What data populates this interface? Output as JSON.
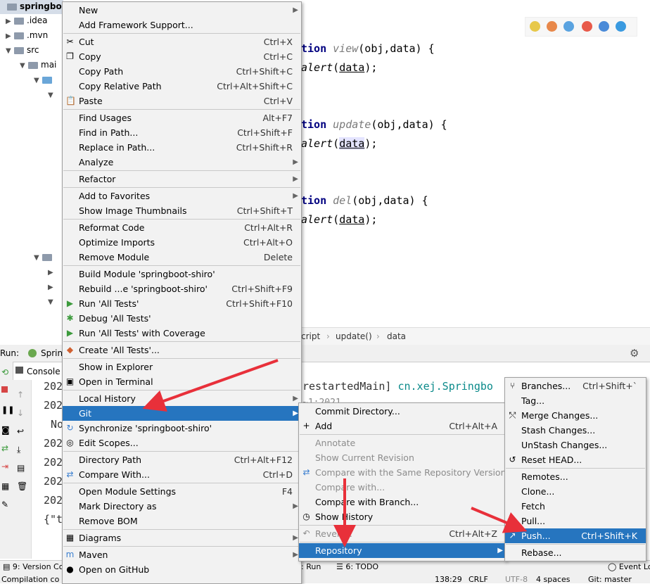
{
  "tree": {
    "root": "springboot",
    "items": [
      ".idea",
      ".mvn",
      "src",
      "mai"
    ]
  },
  "editor": {
    "lines": [
      {
        "kw": "tion",
        "fn": "view",
        "args": "(obj,data) {"
      },
      {
        "call": "alert",
        "arg": "data",
        "end": ";"
      },
      {
        "kw": "tion",
        "fn": "update",
        "args": "(obj,data) {"
      },
      {
        "call": "alert",
        "arg": "data",
        "end": ";"
      },
      {
        "kw": "tion",
        "fn": "del",
        "args": "(obj,data) {"
      },
      {
        "call": "alert",
        "arg": "data",
        "end": ";"
      }
    ],
    "breadcrumb": [
      "cript",
      "update()",
      "data"
    ]
  },
  "run": {
    "label": "Run:",
    "tab": "Sprin",
    "console_tab": "Console",
    "log_prefixes": [
      "202",
      "202",
      "No",
      "202",
      "202",
      "202",
      "202",
      "{\"t"
    ],
    "log_fragment_main": "restartedMain]",
    "log_fragment_class": "cn.xej.Springbo",
    "log_fragment_2": "~1:2021"
  },
  "statusbar": {
    "version_control": "9: Version Co",
    "run_tab": ": Run",
    "todo": "6: TODO",
    "event_log": "Event Lo",
    "compilation": "Compilation co",
    "position": "138:29",
    "line_sep": "CRLF",
    "encoding": "UTF-8",
    "indent": "4 spaces",
    "branch": "Git: master"
  },
  "context_menu": [
    {
      "label": "New",
      "submenu": true
    },
    {
      "label": "Add Framework Support..."
    },
    {
      "sep": true
    },
    {
      "label": "Cut",
      "shortcut": "Ctrl+X",
      "icon": "scissors-icon"
    },
    {
      "label": "Copy",
      "shortcut": "Ctrl+C",
      "icon": "copy-icon"
    },
    {
      "label": "Copy Path",
      "shortcut": "Ctrl+Shift+C"
    },
    {
      "label": "Copy Relative Path",
      "shortcut": "Ctrl+Alt+Shift+C"
    },
    {
      "label": "Paste",
      "shortcut": "Ctrl+V",
      "icon": "paste-icon"
    },
    {
      "sep": true
    },
    {
      "label": "Find Usages",
      "shortcut": "Alt+F7"
    },
    {
      "label": "Find in Path...",
      "shortcut": "Ctrl+Shift+F"
    },
    {
      "label": "Replace in Path...",
      "shortcut": "Ctrl+Shift+R"
    },
    {
      "label": "Analyze",
      "submenu": true
    },
    {
      "sep": true
    },
    {
      "label": "Refactor",
      "submenu": true
    },
    {
      "sep": true
    },
    {
      "label": "Add to Favorites",
      "submenu": true
    },
    {
      "label": "Show Image Thumbnails",
      "shortcut": "Ctrl+Shift+T"
    },
    {
      "sep": true
    },
    {
      "label": "Reformat Code",
      "shortcut": "Ctrl+Alt+R"
    },
    {
      "label": "Optimize Imports",
      "shortcut": "Ctrl+Alt+O"
    },
    {
      "label": "Remove Module",
      "shortcut": "Delete"
    },
    {
      "sep": true
    },
    {
      "label": "Build Module 'springboot-shiro'"
    },
    {
      "label": "Rebuild ...e 'springboot-shiro'",
      "shortcut": "Ctrl+Shift+F9"
    },
    {
      "label": "Run 'All Tests'",
      "shortcut": "Ctrl+Shift+F10",
      "icon": "run-icon"
    },
    {
      "label": "Debug 'All Tests'",
      "icon": "debug-icon"
    },
    {
      "label": "Run 'All Tests' with Coverage",
      "icon": "coverage-icon"
    },
    {
      "sep": true
    },
    {
      "label": "Create 'All Tests'...",
      "icon": "create-test-icon"
    },
    {
      "sep": true
    },
    {
      "label": "Show in Explorer"
    },
    {
      "label": "Open in Terminal",
      "icon": "terminal-icon"
    },
    {
      "sep": true
    },
    {
      "label": "Local History",
      "submenu": true
    },
    {
      "label": "Git",
      "submenu": true,
      "selected": true
    },
    {
      "label": "Synchronize 'springboot-shiro'",
      "icon": "sync-icon"
    },
    {
      "label": "Edit Scopes...",
      "icon": "scopes-icon"
    },
    {
      "sep": true
    },
    {
      "label": "Directory Path",
      "shortcut": "Ctrl+Alt+F12"
    },
    {
      "label": "Compare With...",
      "shortcut": "Ctrl+D",
      "icon": "compare-icon"
    },
    {
      "sep": true
    },
    {
      "label": "Open Module Settings",
      "shortcut": "F4"
    },
    {
      "label": "Mark Directory as",
      "submenu": true
    },
    {
      "label": "Remove BOM"
    },
    {
      "sep": true
    },
    {
      "label": "Diagrams",
      "submenu": true,
      "icon": "diagram-icon"
    },
    {
      "sep": true
    },
    {
      "label": "Maven",
      "submenu": true,
      "icon": "maven-icon"
    },
    {
      "label": "Open on GitHub",
      "icon": "github-icon"
    }
  ],
  "git_menu": [
    {
      "label": "Commit Directory..."
    },
    {
      "label": "Add",
      "shortcut": "Ctrl+Alt+A",
      "icon": "plus-icon"
    },
    {
      "sep": true
    },
    {
      "label": "Annotate",
      "disabled": true
    },
    {
      "label": "Show Current Revision",
      "disabled": true
    },
    {
      "label": "Compare with the Same Repository Version",
      "disabled": true,
      "icon": "compare-icon"
    },
    {
      "label": "Compare with...",
      "disabled": true
    },
    {
      "label": "Compare with Branch..."
    },
    {
      "label": "Show History",
      "icon": "history-icon"
    },
    {
      "sep": true
    },
    {
      "label": "Revert...",
      "shortcut": "Ctrl+Alt+Z",
      "disabled": true,
      "icon": "revert-icon"
    },
    {
      "sep": true
    },
    {
      "label": "Repository",
      "submenu": true,
      "selected": true
    }
  ],
  "repo_menu": [
    {
      "label": "Branches...",
      "shortcut": "Ctrl+Shift+`",
      "icon": "branch-icon"
    },
    {
      "label": "Tag..."
    },
    {
      "label": "Merge Changes...",
      "icon": "merge-icon"
    },
    {
      "label": "Stash Changes..."
    },
    {
      "label": "UnStash Changes..."
    },
    {
      "label": "Reset HEAD...",
      "icon": "reset-icon"
    },
    {
      "sep": true
    },
    {
      "label": "Remotes..."
    },
    {
      "label": "Clone..."
    },
    {
      "label": "Fetch"
    },
    {
      "label": "Pull...",
      "icon": "pull-icon"
    },
    {
      "label": "Push...",
      "shortcut": "Ctrl+Shift+K",
      "selected": true,
      "icon": "push-icon"
    },
    {
      "sep": true
    },
    {
      "label": "Rebase..."
    }
  ],
  "colors": {
    "selected": "#2675bf",
    "arrow": "#e8303a",
    "menu_bg": "#f2f2f2"
  }
}
